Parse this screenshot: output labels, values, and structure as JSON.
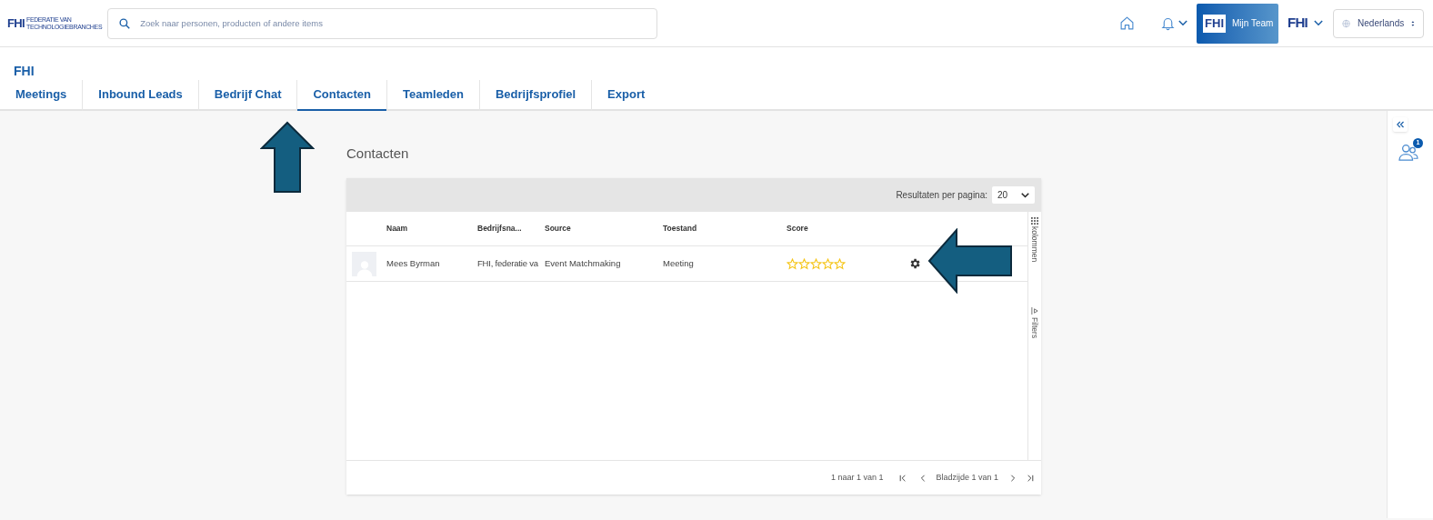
{
  "logo": {
    "mark": "FHI",
    "line_1": "FEDERATIE VAN",
    "line_2": "TECHNOLOGIEBRANCHES"
  },
  "search": {
    "placeholder": "Zoek naar personen, producten of andere items"
  },
  "header": {
    "team_logo": "FHI",
    "team_button": "Mijn Team",
    "org_logo": "FHI",
    "language": "Nederlands"
  },
  "page_title": "FHI",
  "tabs": [
    {
      "label": "Meetings",
      "selected": false
    },
    {
      "label": "Inbound Leads",
      "selected": false
    },
    {
      "label": "Bedrijf Chat",
      "selected": false
    },
    {
      "label": "Contacten",
      "selected": true
    },
    {
      "label": "Teamleden",
      "selected": false
    },
    {
      "label": "Bedrijfsprofiel",
      "selected": false
    },
    {
      "label": "Export",
      "selected": false
    }
  ],
  "section_title": "Contacten",
  "table": {
    "page_size_label": "Resultaten per pagina:",
    "page_size": "20",
    "columns": [
      "Naam",
      "Bedrijfsna...",
      "Source",
      "Toestand",
      "Score"
    ],
    "rows": [
      {
        "name": "Mees Byrman",
        "company": "FHI, federatie va",
        "source": "Event Matchmaking",
        "status": "Meeting",
        "stars": 0
      }
    ],
    "side_tabs": [
      "kolommen",
      "Filters"
    ],
    "pagination": {
      "summary": "1 naar 1 van 1",
      "page": "Bladzijde 1 van 1"
    }
  },
  "sidebar": {
    "badge": "1"
  }
}
